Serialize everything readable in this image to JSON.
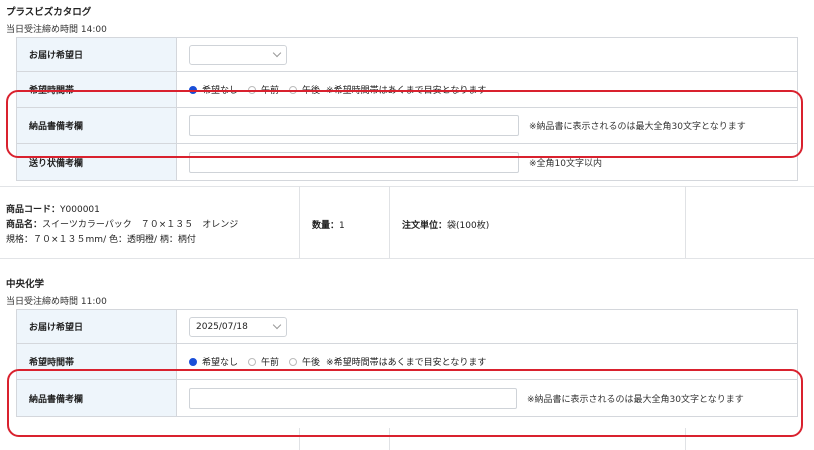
{
  "sections": [
    {
      "title": "プラスビズカタログ",
      "deadline": "当日受注締め時間 14:00",
      "delivery_date": {
        "label": "お届け希望日",
        "value": ""
      },
      "time_slot": {
        "label": "希望時間帯",
        "options": [
          "希望なし",
          "午前",
          "午後"
        ],
        "selected": "希望なし",
        "note": "※希望時間帯はあくまで目安となります"
      },
      "invoice_remarks": {
        "label": "納品書備考欄",
        "note": "※納品書に表示されるのは最大全角30文字となります"
      },
      "shipping_remarks": {
        "label": "送り状備考欄",
        "note": "※全角10文字以内"
      }
    },
    {
      "title": "中央化学",
      "deadline": "当日受注締め時間 11:00",
      "delivery_date": {
        "label": "お届け希望日",
        "value": "2025/07/18"
      },
      "time_slot": {
        "label": "希望時間帯",
        "options": [
          "希望なし",
          "午前",
          "午後"
        ],
        "selected": "希望なし",
        "note": "※希望時間帯はあくまで目安となります"
      },
      "invoice_remarks": {
        "label": "納品書備考欄",
        "note": "※納品書に表示されるのは最大全角30文字となります"
      }
    }
  ],
  "product": {
    "code_label": "商品コード：",
    "code": "Y000001",
    "name_label": "商品名：",
    "name": "スイーツカラーパック　７０×１３５　オレンジ",
    "spec": "規格：７０×１３５mm/ 色：透明橙/ 柄：柄付",
    "qty_label": "数量：",
    "qty": "1",
    "unit_label": "注文単位：",
    "unit": "袋(100枚)"
  },
  "colors": {
    "highlight": "#d9212e",
    "label_bg": "#eef5fb",
    "radio_on": "#1a4fd8"
  }
}
